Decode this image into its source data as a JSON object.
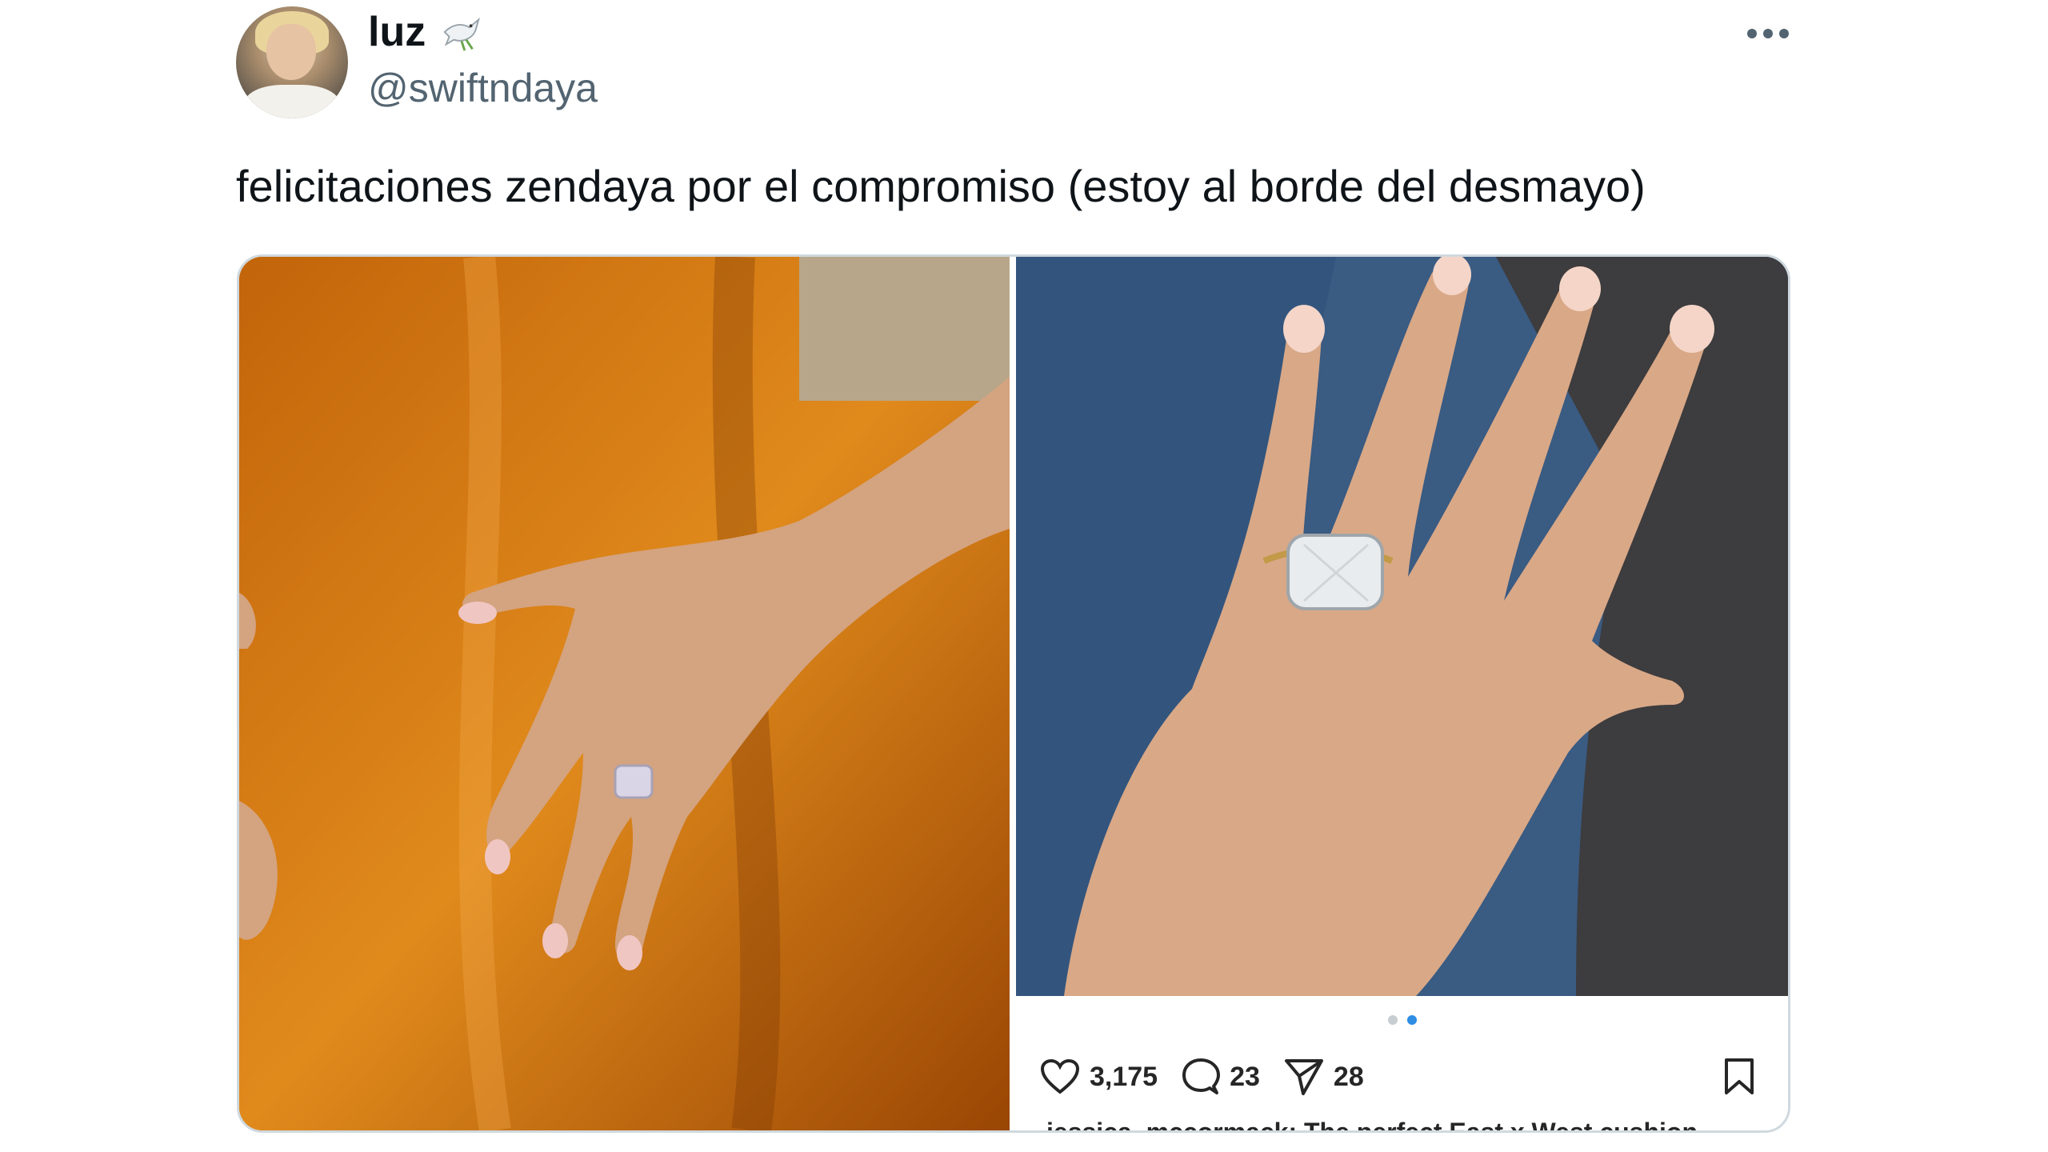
{
  "author": {
    "display_name": "luz",
    "handle": "@swiftndaya",
    "name_emoji_icon": "dove-icon"
  },
  "tweet": {
    "text": "felicitaciones zendaya por el compromiso (estoy al borde del desmayo)",
    "more_icon": "more-horizontal-icon"
  },
  "media": {
    "left_image": "hand-with-ring-on-orange-satin",
    "right_image": "hand-with-ring-on-denim",
    "carousel": {
      "count": 2,
      "active_index": 1
    },
    "engagement": {
      "likes": "3,175",
      "comments": "23",
      "shares": "28"
    },
    "caption_preview": "jessica_mccormack: The perfect East x West cushion"
  },
  "colors": {
    "text_primary": "#0f1419",
    "text_secondary": "#536471",
    "border": "#cfd9de",
    "dot_active": "#2f8de4"
  }
}
